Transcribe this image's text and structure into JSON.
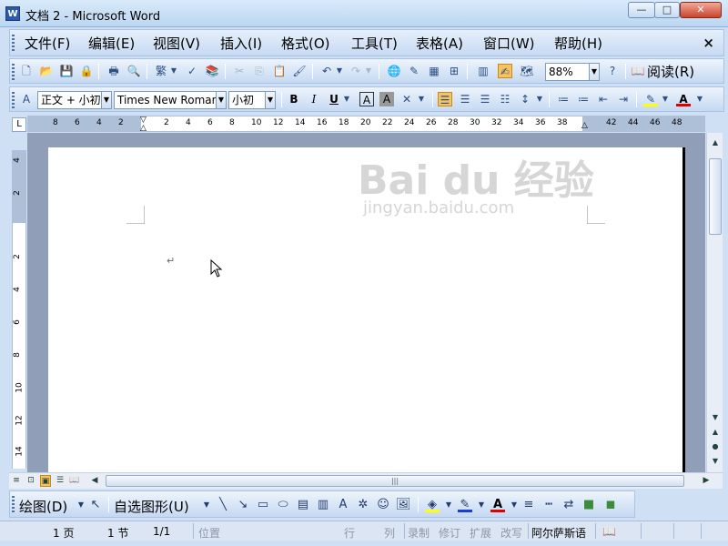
{
  "window": {
    "app_icon": "W",
    "title": "文档 2 - Microsoft Word",
    "minimize": "—",
    "maximize": "□",
    "close": "✕"
  },
  "menubar": {
    "items": [
      "文件(F)",
      "编辑(E)",
      "视图(V)",
      "插入(I)",
      "格式(O)",
      "工具(T)",
      "表格(A)",
      "窗口(W)",
      "帮助(H)"
    ],
    "close_doc": "×"
  },
  "standard_toolbar": {
    "zoom": "88%",
    "read_label": "阅读(R)"
  },
  "format_toolbar": {
    "style": "正文 + 小初",
    "font": "Times New Roman",
    "size": "小初",
    "bold": "B",
    "italic": "I",
    "underline": "U"
  },
  "ruler": {
    "corner": "L",
    "h_numbers": [
      "8",
      "6",
      "4",
      "2",
      "2",
      "4",
      "6",
      "8",
      "10",
      "12",
      "14",
      "16",
      "18",
      "20",
      "22",
      "24",
      "26",
      "28",
      "30",
      "32",
      "34",
      "36",
      "38",
      "42",
      "44",
      "46",
      "48"
    ],
    "v_numbers": [
      "4",
      "2",
      "2",
      "4",
      "6",
      "8",
      "10",
      "12",
      "14"
    ]
  },
  "document": {
    "paragraph_mark": "↵",
    "watermark_main": "Bai du 经验",
    "watermark_sub": "jingyan.baidu.com"
  },
  "drawing_toolbar": {
    "draw_label": "绘图(D)",
    "autoshape_label": "自选图形(U)"
  },
  "statusbar": {
    "page": "1 页",
    "section": "1 节",
    "page_count": "1/1",
    "position": "位置",
    "line": "行",
    "column": "列",
    "record": "录制",
    "revise": "修订",
    "extend": "扩展",
    "overwrite": "改写",
    "language": "阿尔萨斯语"
  }
}
